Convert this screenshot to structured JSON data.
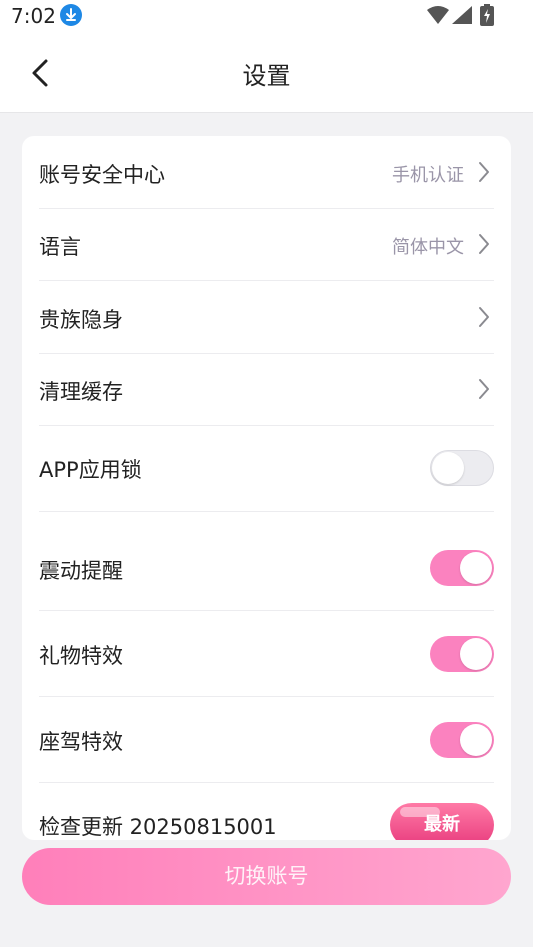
{
  "status_bar": {
    "time": "7:02"
  },
  "header": {
    "title": "设置"
  },
  "settings": {
    "account_security": {
      "label": "账号安全中心",
      "value": "手机认证"
    },
    "language": {
      "label": "语言",
      "value": "简体中文"
    },
    "noble_stealth": {
      "label": "贵族隐身"
    },
    "clear_cache": {
      "label": "清理缓存"
    },
    "app_lock": {
      "label": "APP应用锁",
      "enabled": false
    },
    "vibration": {
      "label": "震动提醒",
      "enabled": true
    },
    "gift_effects": {
      "label": "礼物特效",
      "enabled": true
    },
    "mount_effects": {
      "label": "座驾特效",
      "enabled": true
    },
    "check_update": {
      "label": "检查更新 20250815001",
      "badge": "最新"
    }
  },
  "footer": {
    "switch_account_label": "切换账号"
  },
  "colors": {
    "accent": "#fb82bf",
    "toggle_off": "#ececf0",
    "background": "#f2f2f4"
  }
}
